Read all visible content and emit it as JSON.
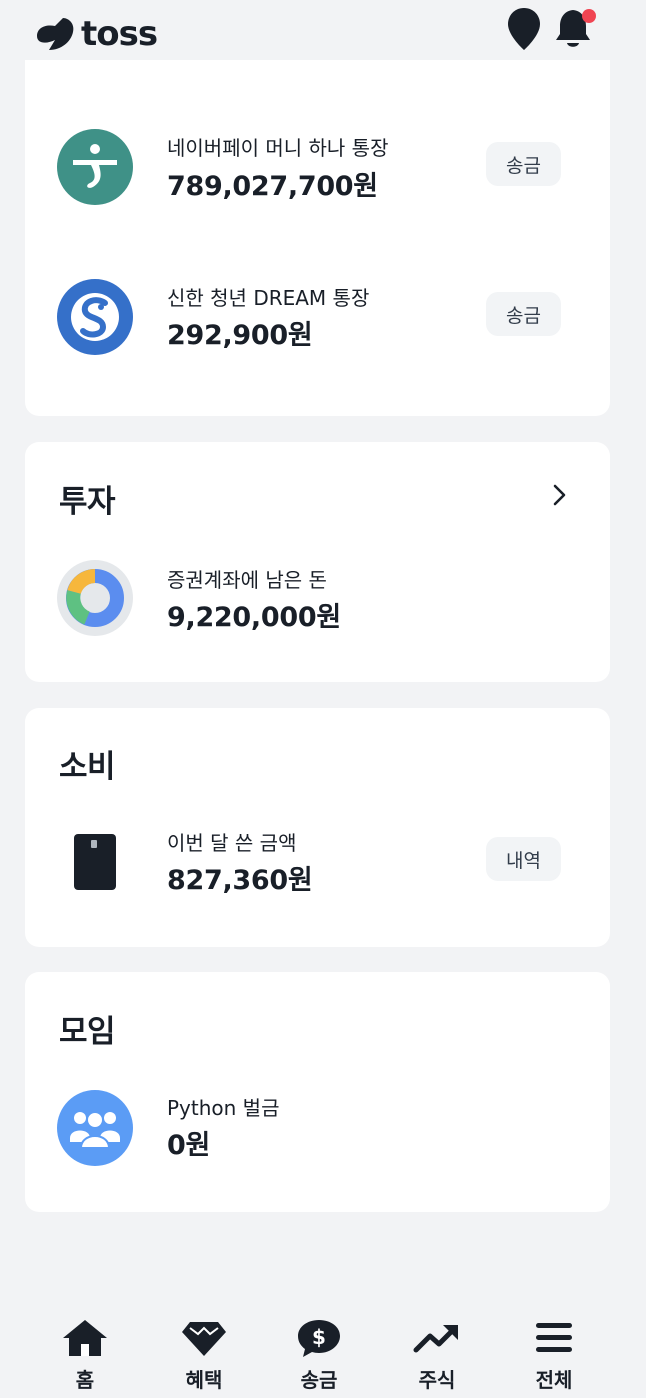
{
  "header": {
    "logo_text": "toss",
    "icons": [
      "toss-logo-icon",
      "location-pin-icon",
      "bell-icon"
    ],
    "notification_dot_color": "#f04452"
  },
  "accounts": [
    {
      "name": "네이버페이 머니 하나 통장",
      "amount": "789,027,700원",
      "action": "송금",
      "icon": "hana-bank-icon",
      "icon_color": "#3f9187"
    },
    {
      "name": "신한 청년 DREAM 통장",
      "amount": "292,900원",
      "action": "송금",
      "icon": "shinhan-bank-icon",
      "icon_color": "#3570c9"
    }
  ],
  "invest": {
    "title": "투자",
    "item_label": "증권계좌에 남은 돈",
    "item_amount": "9,220,000원"
  },
  "spend": {
    "title": "소비",
    "item_label": "이번 달 쓴 금액",
    "item_amount": "827,360원",
    "action": "내역"
  },
  "group": {
    "title": "모임",
    "item_label": "Python 벌금",
    "item_amount": "0원"
  },
  "tabbar": {
    "tabs": [
      {
        "label": "홈",
        "icon": "home-icon"
      },
      {
        "label": "혜택",
        "icon": "gem-icon"
      },
      {
        "label": "송금",
        "icon": "dollar-chat-icon"
      },
      {
        "label": "주식",
        "icon": "trending-up-icon"
      },
      {
        "label": "전체",
        "icon": "menu-icon"
      }
    ]
  }
}
